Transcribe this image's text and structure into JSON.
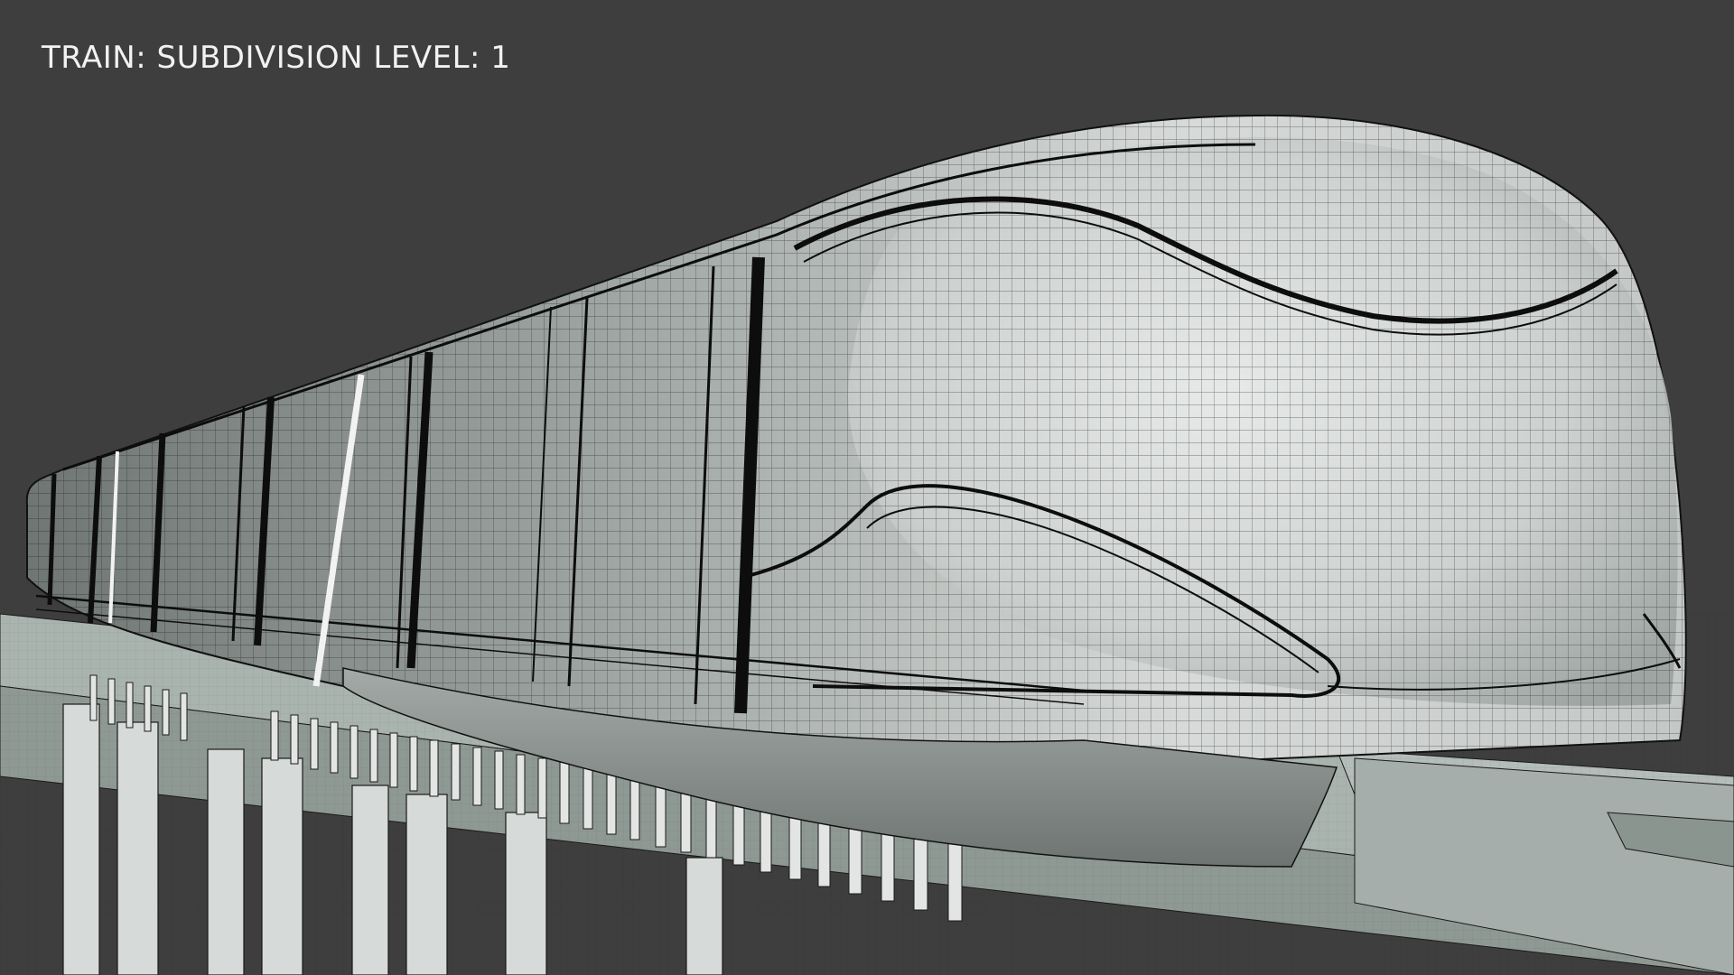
{
  "viewport": {
    "overlay_text": "TRAIN: SUBDIVISION LEVEL: 1",
    "background_color": "#3e3e3e"
  },
  "scene": {
    "subject": "train",
    "subdivision_level": 1,
    "colors": {
      "train_surface": "#c9ccca",
      "guideway": "#a9b3ae",
      "pylons": "#d8dcda",
      "wire": "#1a1a1a",
      "panel_seams": "#0d0d0d",
      "highlight_band": "#f2f2f2"
    }
  }
}
